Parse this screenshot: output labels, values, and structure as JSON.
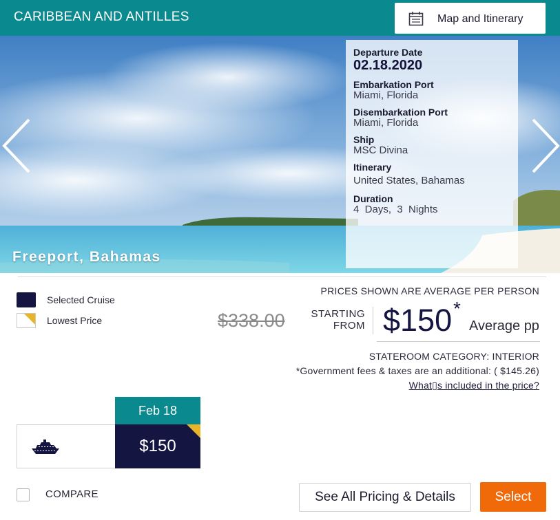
{
  "header": {
    "title": "CARIBBEAN AND ANTILLES",
    "map_button_label": "Map and Itinerary",
    "map_button_icon": "calendar-icon"
  },
  "hero": {
    "location": "Freeport, Bahamas",
    "prev_icon": "chevron-left-icon",
    "next_icon": "chevron-right-icon",
    "info": {
      "departure_label": "Departure Date",
      "departure_value": "02.18.2020",
      "embark_label": "Embarkation Port",
      "embark_value": "Miami, Florida",
      "disembark_label": "Disembarkation Port",
      "disembark_value": "Miami, Florida",
      "ship_label": "Ship",
      "ship_value": "MSC Divina",
      "itinerary_label": "Itinerary",
      "itinerary_value": "United States, Bahamas",
      "duration_label": "Duration",
      "duration_value": "4  Days,  3  Nights"
    }
  },
  "legend": {
    "selected_label": "Selected Cruise",
    "lowest_label": "Lowest Price",
    "selected_color": "#141540",
    "lowest_color": "#e8b52a"
  },
  "pricing": {
    "note": "PRICES SHOWN ARE AVERAGE PER PERSON",
    "old_price": "$338.00",
    "starting_line1": "STARTING",
    "starting_line2": "FROM",
    "price": "$150",
    "asterisk": "*",
    "avg_label": "Average pp",
    "stateroom": "STATEROOM CATEGORY: INTERIOR",
    "gov_fees": "*Government fees & taxes are an additional: ( $145.26)",
    "included_link": "What▯s included in the price?"
  },
  "calendar": {
    "date_label": "Feb 18",
    "cell_price": "$150",
    "ship_icon": "cruise-ship-icon"
  },
  "footer": {
    "compare_label": "COMPARE",
    "see_all_label": "See All Pricing & Details",
    "select_label": "Select"
  },
  "colors": {
    "teal": "#0a8a8f",
    "navy": "#141540",
    "orange": "#f06a0a",
    "gold": "#e8b52a"
  }
}
